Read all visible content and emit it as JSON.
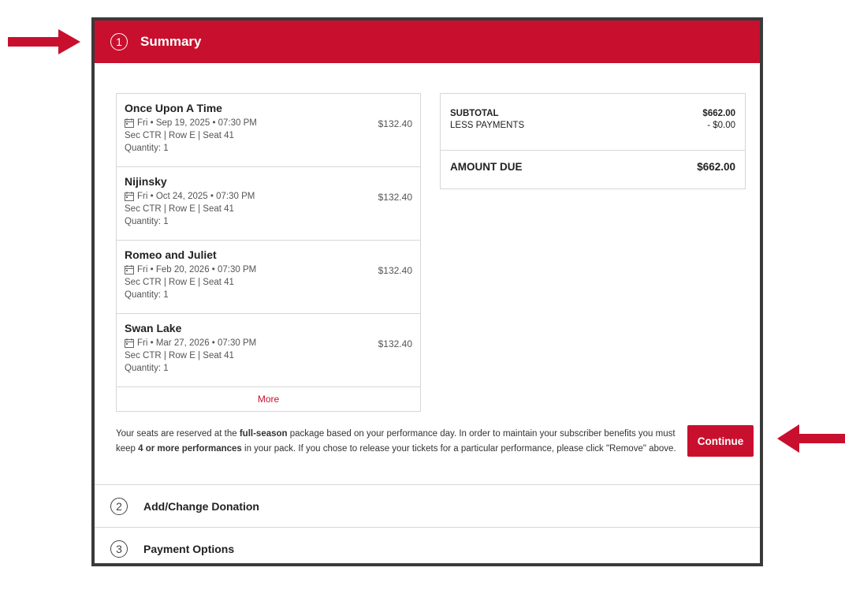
{
  "steps": [
    {
      "number": "1",
      "title": "Summary"
    },
    {
      "number": "2",
      "title": "Add/Change Donation"
    },
    {
      "number": "3",
      "title": "Payment Options"
    }
  ],
  "items": [
    {
      "name": "Once Upon A Time",
      "date": "Fri • Sep 19, 2025 • 07:30 PM",
      "seat": "Sec CTR | Row E  |  Seat 41",
      "quantity": "Quantity: 1",
      "price": "$132.40"
    },
    {
      "name": "Nijinsky",
      "date": "Fri • Oct 24, 2025 • 07:30 PM",
      "seat": "Sec CTR | Row E  |  Seat 41",
      "quantity": "Quantity: 1",
      "price": "$132.40"
    },
    {
      "name": "Romeo and Juliet",
      "date": "Fri • Feb 20, 2026 • 07:30 PM",
      "seat": "Sec CTR | Row E  |  Seat 41",
      "quantity": "Quantity: 1",
      "price": "$132.40"
    },
    {
      "name": "Swan Lake",
      "date": "Fri • Mar 27, 2026 • 07:30 PM",
      "seat": "Sec CTR | Row E  |  Seat 41",
      "quantity": "Quantity: 1",
      "price": "$132.40"
    }
  ],
  "more_label": "More",
  "totals": {
    "subtotal_label": "SUBTOTAL",
    "subtotal_value": "$662.00",
    "less_label": "LESS PAYMENTS",
    "less_value": "- $0.00",
    "due_label": "AMOUNT DUE",
    "due_value": "$662.00"
  },
  "notice": {
    "p1": "Your seats are reserved at the ",
    "b1": "full-season",
    "p2": " package based on your performance day.  In order to maintain your subscriber benefits you must keep ",
    "b2": "4 or more performances",
    "p3": " in your pack. If you chose to release your tickets for a particular performance, please click \"Remove\" above."
  },
  "continue_label": "Continue",
  "icons": {
    "calendar": "calendar-icon",
    "arrow": "arrow-icon"
  },
  "colors": {
    "brand": "#c8102e",
    "frame": "#3a3a3a"
  }
}
